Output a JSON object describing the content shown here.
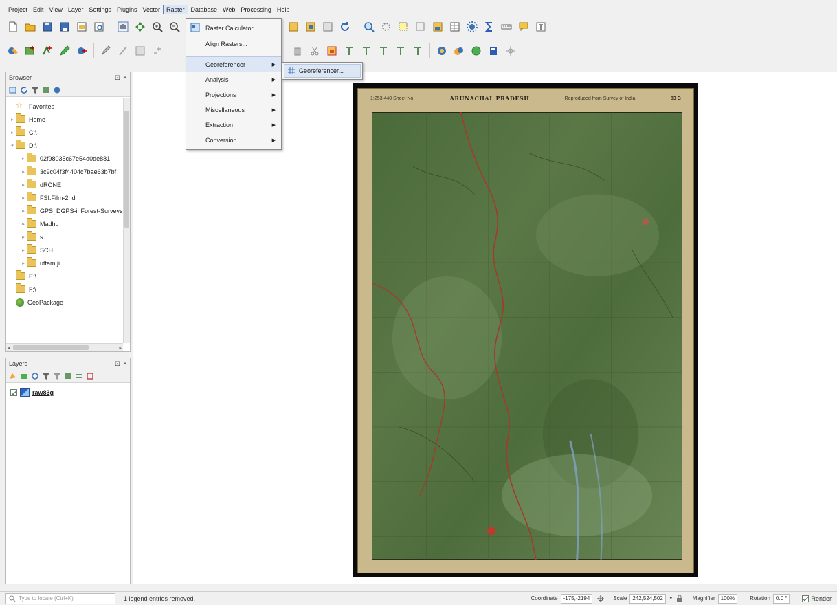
{
  "menubar": {
    "items": [
      "Project",
      "Edit",
      "View",
      "Layer",
      "Settings",
      "Plugins",
      "Vector",
      "Raster",
      "Database",
      "Web",
      "Processing",
      "Help"
    ],
    "active_index": 7
  },
  "raster_menu": {
    "items": [
      {
        "label": "Raster Calculator...",
        "icon": "raster-calculator-icon",
        "submenu": false
      },
      {
        "label": "Align Rasters...",
        "icon": "",
        "submenu": false
      },
      {
        "label": "Georeferencer",
        "icon": "",
        "submenu": true
      },
      {
        "label": "Analysis",
        "icon": "",
        "submenu": true
      },
      {
        "label": "Projections",
        "icon": "",
        "submenu": true
      },
      {
        "label": "Miscellaneous",
        "icon": "",
        "submenu": true
      },
      {
        "label": "Extraction",
        "icon": "",
        "submenu": true
      },
      {
        "label": "Conversion",
        "icon": "",
        "submenu": true
      }
    ],
    "highlighted_index": 2
  },
  "georeferencer_submenu": {
    "label": "Georeferencer...",
    "icon": "georeferencer-grid-icon"
  },
  "browser_panel": {
    "title": "Browser",
    "close_glyph": "×",
    "float_glyph": "⊡",
    "items": [
      {
        "label": "Favorites",
        "type": "favorites",
        "expander": ""
      },
      {
        "label": "Home",
        "type": "folder",
        "expander": "▸"
      },
      {
        "label": "C:\\",
        "type": "folder",
        "expander": "▸"
      },
      {
        "label": "D:\\",
        "type": "folder",
        "expander": "▾"
      },
      {
        "label": "02f98035c67e54d0de881",
        "type": "folder",
        "expander": "▸",
        "indent": 1
      },
      {
        "label": "3c9c04f3f4404c7bae63b7bf",
        "type": "folder",
        "expander": "▸",
        "indent": 1
      },
      {
        "label": "dRONE",
        "type": "folder",
        "expander": "▸",
        "indent": 1
      },
      {
        "label": "FSI.Film-2nd",
        "type": "folder",
        "expander": "▸",
        "indent": 1
      },
      {
        "label": "GPS_DGPS-inForest-Surveys",
        "type": "folder",
        "expander": "▸",
        "indent": 1
      },
      {
        "label": "Madhu",
        "type": "folder",
        "expander": "▸",
        "indent": 1
      },
      {
        "label": "s",
        "type": "folder",
        "expander": "▸",
        "indent": 1
      },
      {
        "label": "SCH",
        "type": "folder",
        "expander": "▸",
        "indent": 1
      },
      {
        "label": "uttam ji",
        "type": "folder",
        "expander": "▸",
        "indent": 1
      },
      {
        "label": "E:\\",
        "type": "folder",
        "expander": ""
      },
      {
        "label": "F:\\",
        "type": "folder",
        "expander": ""
      },
      {
        "label": "GeoPackage",
        "type": "geopackage",
        "expander": ""
      }
    ]
  },
  "layers_panel": {
    "title": "Layers",
    "close_glyph": "×",
    "float_glyph": "⊡",
    "layers": [
      {
        "name": "raw83g",
        "checked": true,
        "type": "raster"
      }
    ]
  },
  "map": {
    "title": "ARUNACHAL PRADESH",
    "sheet_number": "83 G",
    "header_left": "1:253,440 Sheet No.",
    "header_right": "Reproduced from Survey of India"
  },
  "statusbar": {
    "locator_placeholder": "Type to locate (Ctrl+K)",
    "message": "1 legend entries removed.",
    "coordinate_label": "Coordinate",
    "coordinate_value": "-175,-2194",
    "scale_label": "Scale",
    "scale_value": "242,524,502",
    "magnifier_label": "Magnifier",
    "magnifier_value": "100%",
    "rotation_label": "Rotation",
    "rotation_value": "0.0 °",
    "render_label": "Render"
  },
  "colors": {
    "map_green": "#4d6a3a",
    "map_paper": "#c9b98d",
    "river_red": "#a43a2a",
    "menu_highlight": "#dce6f4"
  }
}
